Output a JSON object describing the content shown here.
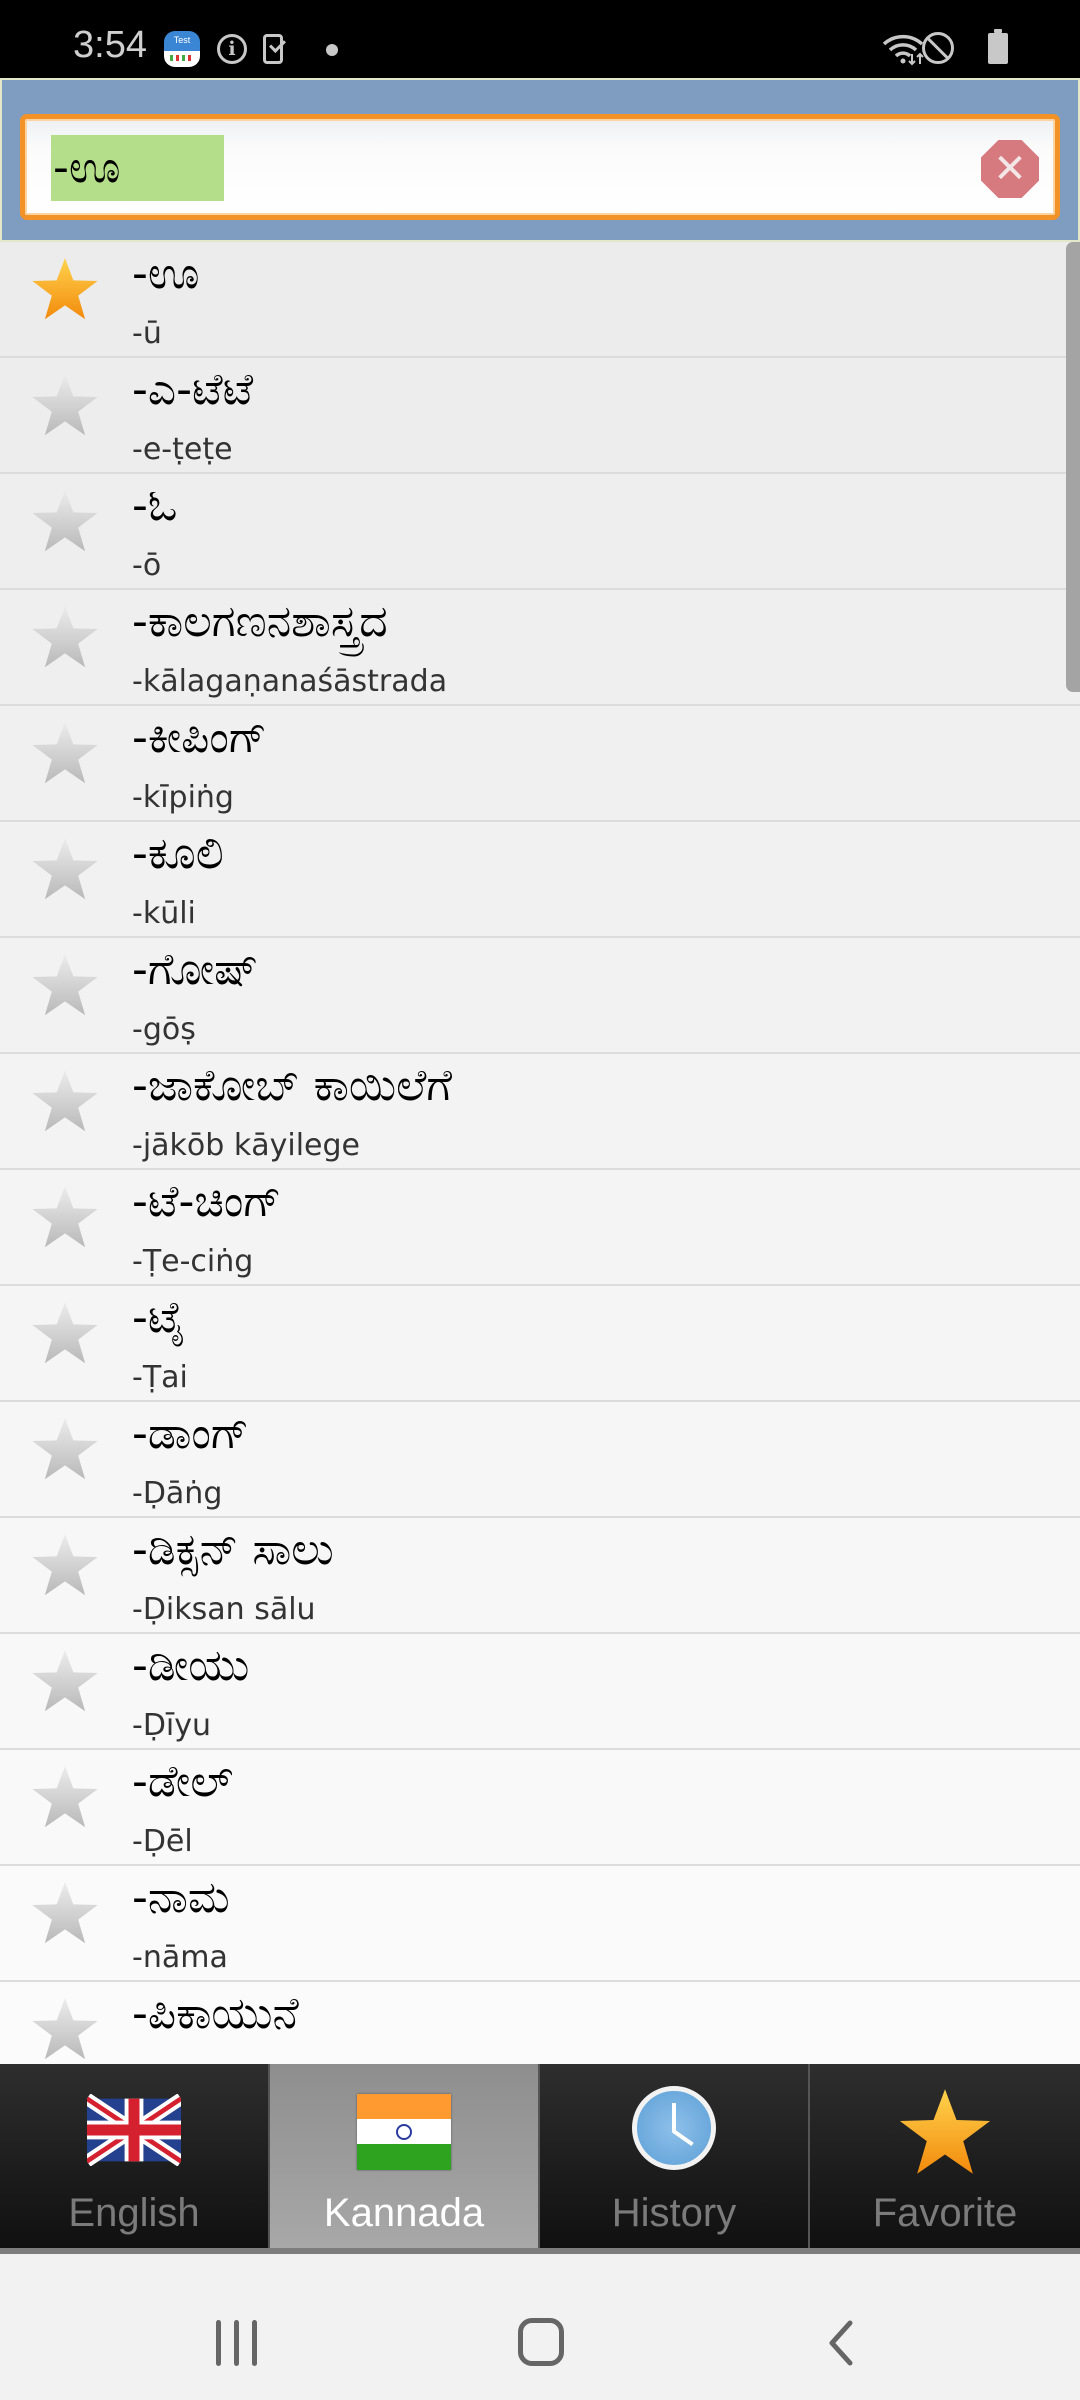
{
  "status_bar": {
    "time": "3:54",
    "notification_icons": [
      "test-app-icon",
      "info-icon",
      "phone-check-icon",
      "dot-icon"
    ],
    "system_icons": [
      "wifi-icon",
      "do-not-disturb-icon",
      "battery-icon"
    ],
    "test_icon_label": "Test",
    "info_glyph": "i"
  },
  "search": {
    "value": "-ಊ",
    "clear_glyph": "✕",
    "colors": {
      "border": "#f39327",
      "header_bg": "#7f9dc0",
      "highlight": "#b5de8b"
    }
  },
  "words": [
    {
      "word": "-ಊ",
      "translit": "-ū",
      "favorite": true
    },
    {
      "word": "-ಎ-ಟೆಟೆ",
      "translit": "-e-ṭeṭe",
      "favorite": false
    },
    {
      "word": "-ಓ",
      "translit": "-ō",
      "favorite": false
    },
    {
      "word": "-ಕಾಲಗಣನಶಾಸ್ತ್ರದ",
      "translit": "-kālagaṇanaśāstrada",
      "favorite": false
    },
    {
      "word": "-ಕೀಪಿಂಗ್",
      "translit": "-kīpiṅg",
      "favorite": false
    },
    {
      "word": "-ಕೂಲಿ",
      "translit": "-kūli",
      "favorite": false
    },
    {
      "word": "-ಗೋಷ್",
      "translit": "-gōṣ",
      "favorite": false
    },
    {
      "word": "-ಜಾಕೋಬ್ ಕಾಯಿಲೆಗೆ",
      "translit": "-jākōb kāyilege",
      "favorite": false
    },
    {
      "word": "-ಟೆ-ಚಿಂಗ್",
      "translit": "-Ṭe-ciṅg",
      "favorite": false
    },
    {
      "word": "-ಟೈ",
      "translit": "-Ṭai",
      "favorite": false
    },
    {
      "word": "-ಡಾಂಗ್",
      "translit": "-Ḍāṅg",
      "favorite": false
    },
    {
      "word": "-ಡಿಕ್ಸನ್ ಸಾಲು",
      "translit": "-Ḍiksan sālu",
      "favorite": false
    },
    {
      "word": "-ಡೀಯು",
      "translit": "-Ḍīyu",
      "favorite": false
    },
    {
      "word": "-ಡೇಲ್",
      "translit": "-Ḍēl",
      "favorite": false
    },
    {
      "word": "-ನಾಮ",
      "translit": "-nāma",
      "favorite": false
    },
    {
      "word": "-ಪಿಕಾಯುನೆ",
      "translit": "",
      "favorite": false
    }
  ],
  "tabs": [
    {
      "label": "English",
      "icon": "uk-flag-icon",
      "active": false
    },
    {
      "label": "Kannada",
      "icon": "india-flag-icon",
      "active": true
    },
    {
      "label": "History",
      "icon": "clock-icon",
      "active": false
    },
    {
      "label": "Favorite",
      "icon": "star-icon",
      "active": false
    }
  ],
  "nav_bar": {
    "buttons": [
      "recents",
      "home",
      "back"
    ]
  }
}
